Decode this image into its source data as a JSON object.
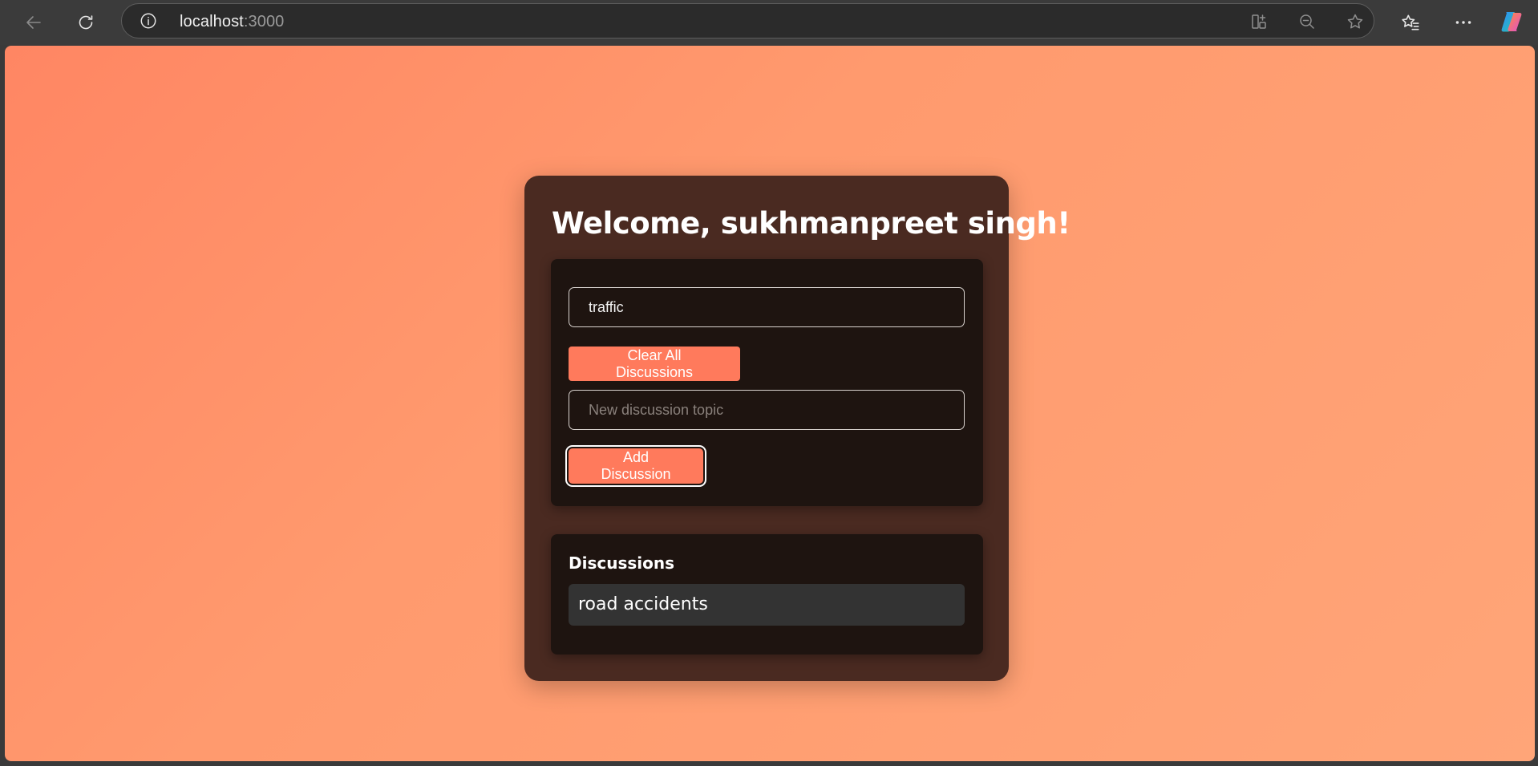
{
  "browser": {
    "url_host": "localhost",
    "url_port": ":3000",
    "icons": {
      "back": "back-arrow-icon",
      "reload": "reload-icon",
      "site_info": "info-icon",
      "split_screen": "split-screen-icon",
      "zoom": "zoom-out-icon",
      "favorite": "star-icon",
      "favorites": "favorites-icon",
      "more": "more-icon",
      "copilot": "copilot-icon"
    }
  },
  "page": {
    "background_colors": [
      "#ff8663",
      "#ffa578"
    ],
    "accent": "#ff7a5c",
    "welcome_title": "Welcome, sukhmanpreet singh!",
    "form": {
      "search_value": "traffic",
      "clear_label": "Clear All Discussions",
      "topic_value": "",
      "topic_placeholder": "New discussion topic",
      "add_label": "Add Discussion"
    },
    "discussions": {
      "heading": "Discussions",
      "items": [
        "road accidents"
      ]
    }
  }
}
